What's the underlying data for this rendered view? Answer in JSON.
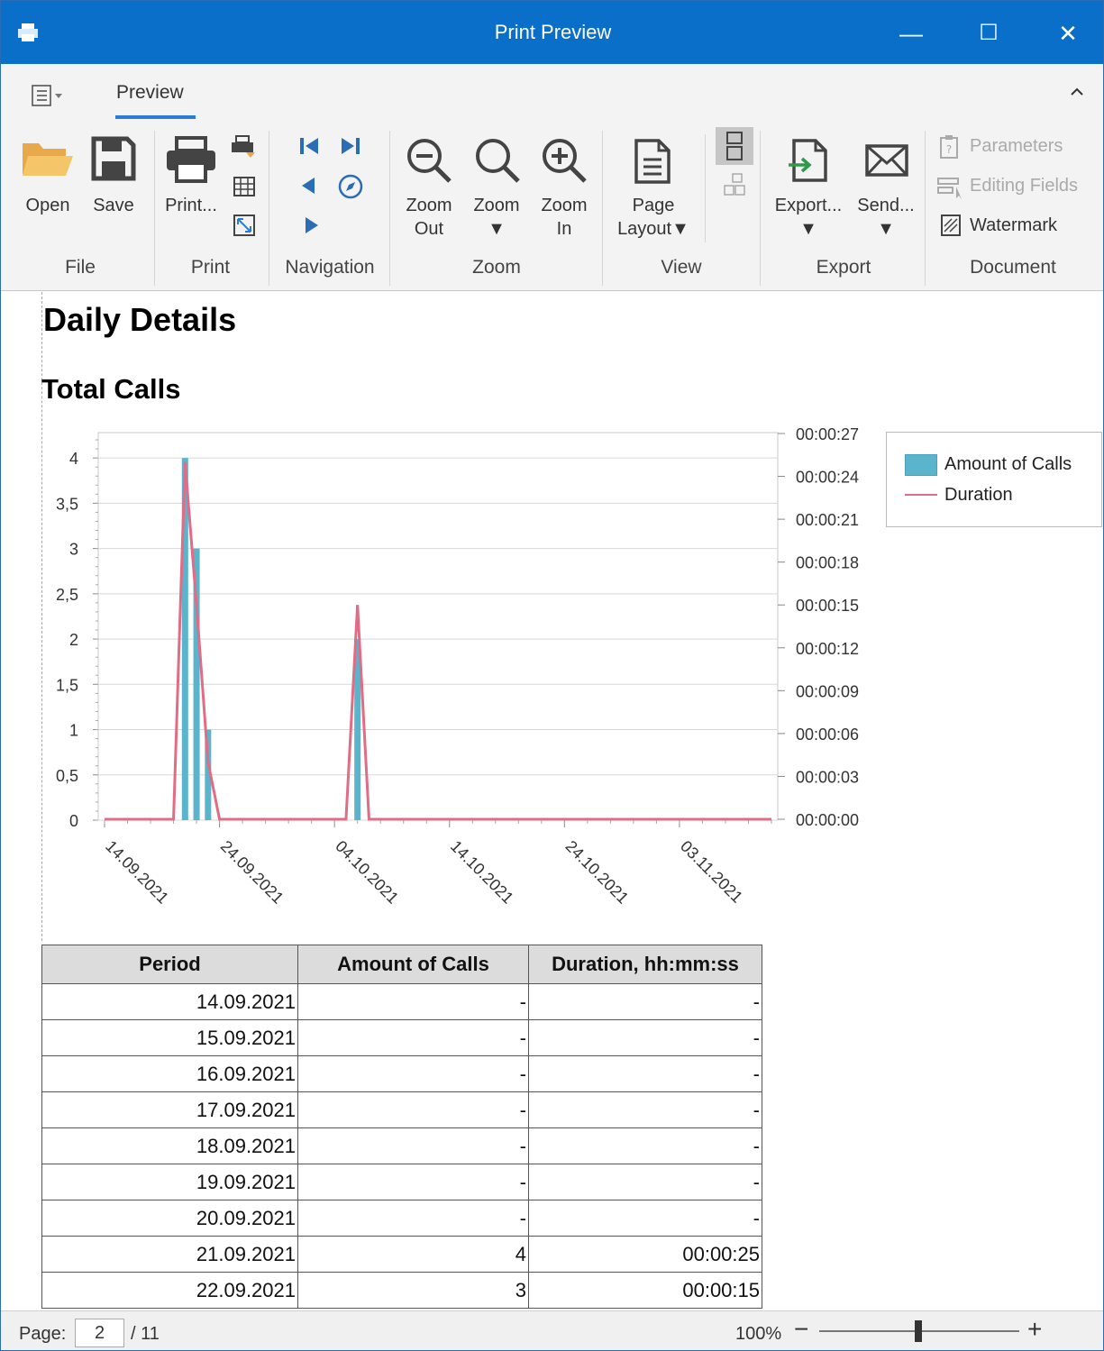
{
  "window": {
    "title": "Print Preview",
    "minimize": "—",
    "maximize": "☐",
    "close": "✕"
  },
  "ribbon": {
    "tab": "Preview",
    "groups": {
      "file": "File",
      "print": "Print",
      "navigation": "Navigation",
      "zoom": "Zoom",
      "view": "View",
      "export": "Export",
      "document": "Document"
    },
    "buttons": {
      "open": "Open",
      "save": "Save",
      "print": "Print...",
      "zoom_out_1": "Zoom",
      "zoom_out_2": "Out",
      "zoom_1": "Zoom",
      "zoom_in_1": "Zoom",
      "zoom_in_2": "In",
      "page_layout_1": "Page",
      "page_layout_2": "Layout",
      "export": "Export...",
      "send": "Send...",
      "parameters": "Parameters",
      "editing_fields": "Editing Fields",
      "watermark": "Watermark"
    }
  },
  "report": {
    "title": "Daily Details",
    "subtitle": "Total Calls"
  },
  "chart_data": {
    "type": "bar",
    "x_ticks": [
      "14.09.2021",
      "24.09.2021",
      "04.10.2021",
      "14.10.2021",
      "24.10.2021",
      "03.11.2021"
    ],
    "y_ticks_left": [
      "0",
      "0,5",
      "1",
      "1,5",
      "2",
      "2,5",
      "3",
      "3,5",
      "4"
    ],
    "y_ticks_right": [
      "00:00:00",
      "00:00:03",
      "00:00:06",
      "00:00:09",
      "00:00:12",
      "00:00:15",
      "00:00:18",
      "00:00:21",
      "00:00:24",
      "00:00:27"
    ],
    "ylim_left": [
      0,
      4.28
    ],
    "ylim_right_seconds": [
      0,
      27
    ],
    "x_start": "14.09.2021",
    "x_end": "11.11.2021",
    "series": [
      {
        "name": "Amount of Calls",
        "type": "bar",
        "axis": "left",
        "color": "#5ab4cc",
        "points": [
          {
            "x": "21.09.2021",
            "y": 4
          },
          {
            "x": "22.09.2021",
            "y": 3
          },
          {
            "x": "23.09.2021",
            "y": 1
          },
          {
            "x": "06.10.2021",
            "y": 2
          }
        ]
      },
      {
        "name": "Duration",
        "type": "line",
        "axis": "right",
        "color": "#e26b85",
        "points": [
          {
            "x": "14.09.2021",
            "y": 0
          },
          {
            "x": "20.09.2021",
            "y": 0
          },
          {
            "x": "21.09.2021",
            "y": 25
          },
          {
            "x": "22.09.2021",
            "y": 15
          },
          {
            "x": "23.09.2021",
            "y": 4
          },
          {
            "x": "24.09.2021",
            "y": 0
          },
          {
            "x": "05.10.2021",
            "y": 0
          },
          {
            "x": "06.10.2021",
            "y": 15
          },
          {
            "x": "07.10.2021",
            "y": 0
          },
          {
            "x": "11.11.2021",
            "y": 0
          }
        ]
      }
    ],
    "legend_position": "top-right",
    "grid": true
  },
  "table": {
    "headers": [
      "Period",
      "Amount of Calls",
      "Duration, hh:mm:ss"
    ],
    "rows": [
      [
        "14.09.2021",
        "-",
        "-"
      ],
      [
        "15.09.2021",
        "-",
        "-"
      ],
      [
        "16.09.2021",
        "-",
        "-"
      ],
      [
        "17.09.2021",
        "-",
        "-"
      ],
      [
        "18.09.2021",
        "-",
        "-"
      ],
      [
        "19.09.2021",
        "-",
        "-"
      ],
      [
        "20.09.2021",
        "-",
        "-"
      ],
      [
        "21.09.2021",
        "4",
        "00:00:25"
      ],
      [
        "22.09.2021",
        "3",
        "00:00:15"
      ]
    ]
  },
  "status": {
    "page_label": "Page:",
    "page": "2",
    "total": "/ 11",
    "zoom": "100%",
    "zoom_level_percent": 100
  }
}
